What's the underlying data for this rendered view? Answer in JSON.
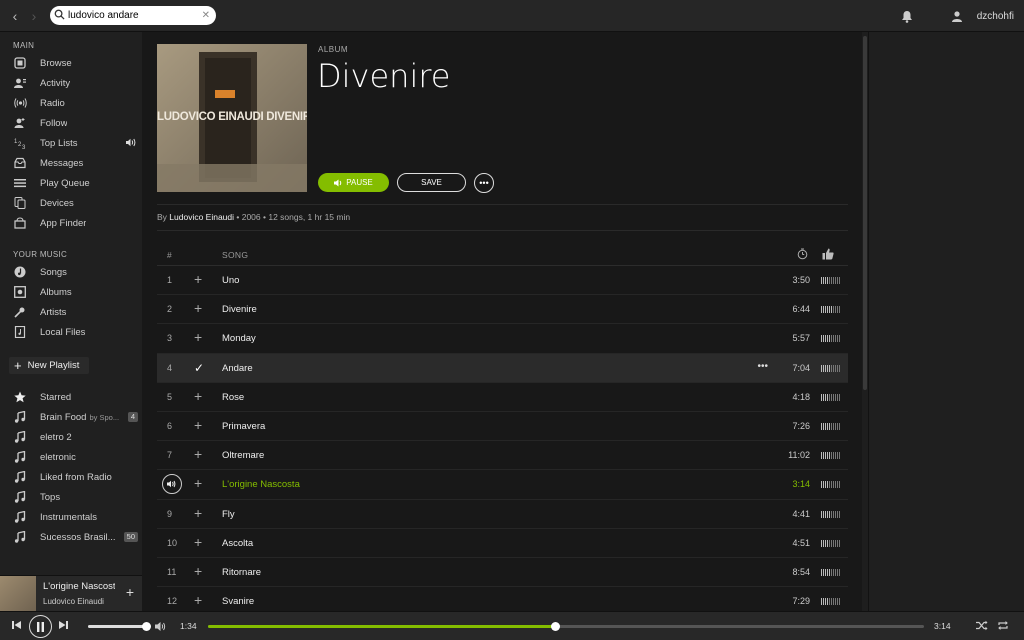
{
  "topbar": {
    "search_value": "ludovico andare",
    "username": "dzchohfi"
  },
  "sidebar": {
    "main_header": "MAIN",
    "main_items": [
      {
        "label": "Browse",
        "icon": "browse-icon"
      },
      {
        "label": "Activity",
        "icon": "activity-icon"
      },
      {
        "label": "Radio",
        "icon": "radio-icon"
      },
      {
        "label": "Follow",
        "icon": "follow-icon"
      },
      {
        "label": "Top Lists",
        "icon": "top-lists-icon"
      },
      {
        "label": "Messages",
        "icon": "messages-icon"
      },
      {
        "label": "Play Queue",
        "icon": "play-queue-icon"
      },
      {
        "label": "Devices",
        "icon": "devices-icon"
      },
      {
        "label": "App Finder",
        "icon": "app-finder-icon"
      }
    ],
    "your_music_header": "YOUR MUSIC",
    "your_music_items": [
      {
        "label": "Songs",
        "icon": "songs-icon"
      },
      {
        "label": "Albums",
        "icon": "albums-icon"
      },
      {
        "label": "Artists",
        "icon": "artists-icon"
      },
      {
        "label": "Local Files",
        "icon": "local-files-icon"
      }
    ],
    "new_playlist": "New Playlist",
    "playlists": [
      {
        "label": "Starred",
        "icon": "star-icon",
        "badge": ""
      },
      {
        "label": "Brain Food",
        "suffix": "by Spo...",
        "icon": "music-note-icon",
        "badge": "4"
      },
      {
        "label": "eletro 2",
        "icon": "music-note-icon",
        "badge": ""
      },
      {
        "label": "eletronic",
        "icon": "music-note-icon",
        "badge": ""
      },
      {
        "label": "Liked from Radio",
        "icon": "music-note-icon",
        "badge": ""
      },
      {
        "label": "Tops",
        "icon": "music-note-icon",
        "badge": ""
      },
      {
        "label": "Instrumentals",
        "icon": "music-note-icon",
        "badge": ""
      },
      {
        "label": "Sucessos Brasil...",
        "icon": "music-note-icon",
        "badge": "50"
      }
    ]
  },
  "mini_player": {
    "title": "L'origine Nascosta",
    "artist": "Ludovico Einaudi"
  },
  "album": {
    "type": "ALBUM",
    "title": "Divenire",
    "cover_text": "LUDOVICO EINAUDI DIVENIRE",
    "pause_label": "PAUSE",
    "save_label": "SAVE",
    "more_label": "•••",
    "by_prefix": "By ",
    "artist": "Ludovico Einaudi",
    "meta": " • 2006 • 12 songs, 1 hr 15 min"
  },
  "tracklist": {
    "header_num": "#",
    "header_song": "SONG",
    "rows": [
      {
        "num": "1",
        "title": "Uno",
        "duration": "3:50",
        "popularity": 0.4
      },
      {
        "num": "2",
        "title": "Divenire",
        "duration": "6:44",
        "popularity": 0.6
      },
      {
        "num": "3",
        "title": "Monday",
        "duration": "5:57",
        "popularity": 0.5
      },
      {
        "num": "4",
        "title": "Andare",
        "duration": "7:04",
        "popularity": 0.5,
        "selected": true,
        "saved": true
      },
      {
        "num": "5",
        "title": "Rose",
        "duration": "4:18",
        "popularity": 0.4
      },
      {
        "num": "6",
        "title": "Primavera",
        "duration": "7:26",
        "popularity": 0.5
      },
      {
        "num": "7",
        "title": "Oltremare",
        "duration": "11:02",
        "popularity": 0.5
      },
      {
        "num": "8",
        "title": "L'origine Nascosta",
        "duration": "3:14",
        "popularity": 0.4,
        "playing": true
      },
      {
        "num": "9",
        "title": "Fly",
        "duration": "4:41",
        "popularity": 0.5
      },
      {
        "num": "10",
        "title": "Ascolta",
        "duration": "4:51",
        "popularity": 0.4
      },
      {
        "num": "11",
        "title": "Ritornare",
        "duration": "8:54",
        "popularity": 0.5
      },
      {
        "num": "12",
        "title": "Svanire",
        "duration": "7:29",
        "popularity": 0.4
      }
    ]
  },
  "player": {
    "current_time": "1:34",
    "total_time": "3:14",
    "progress": 0.485,
    "volume": 1.0
  },
  "colors": {
    "accent": "#84bd00",
    "background": "#181818",
    "sidebar": "#202020"
  }
}
